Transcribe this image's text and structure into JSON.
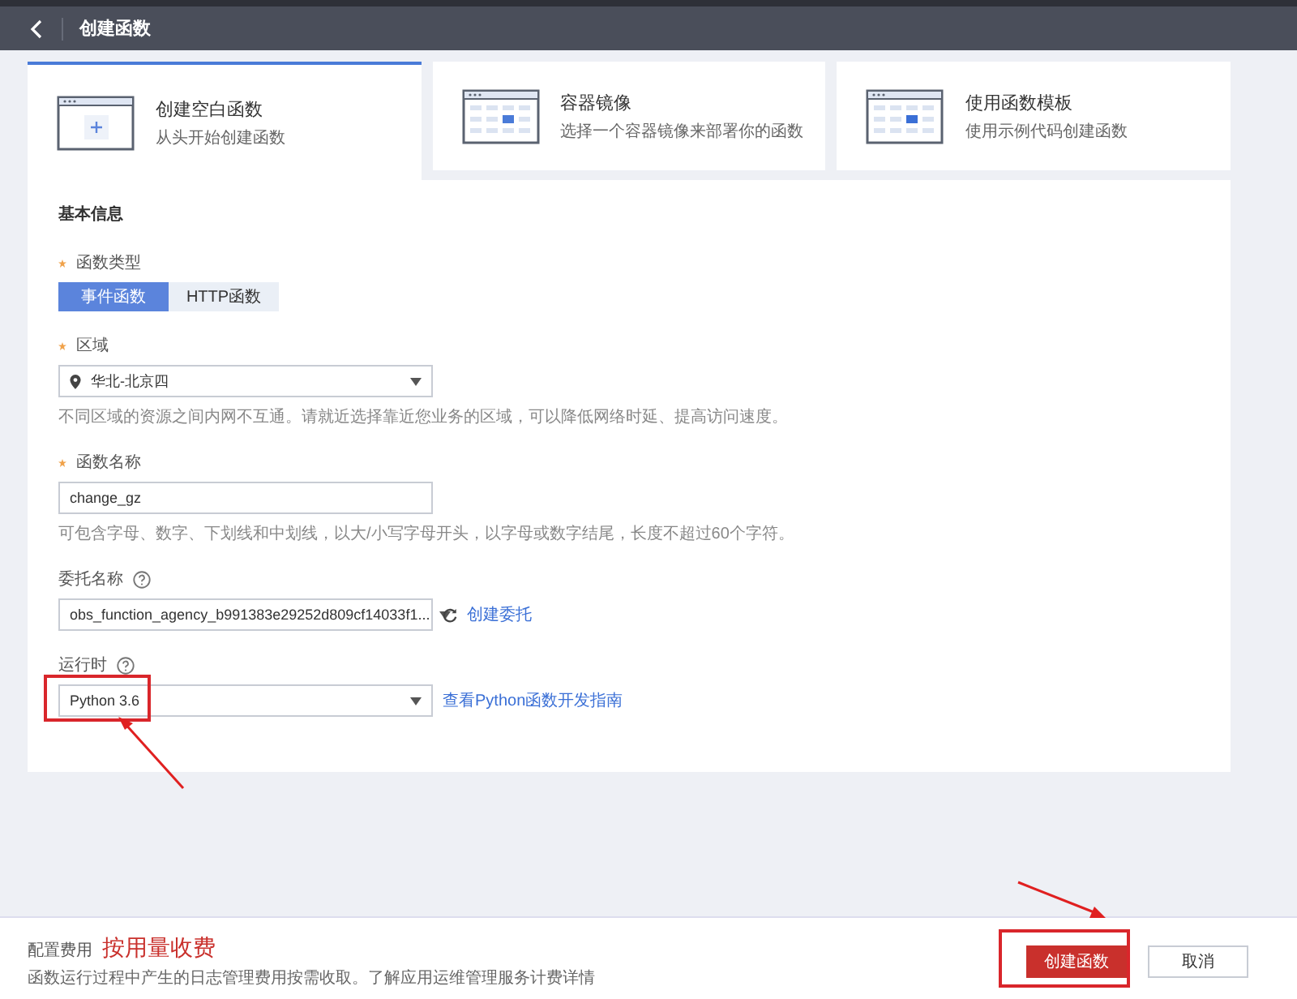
{
  "header": {
    "title": "创建函数"
  },
  "creation_modes": [
    {
      "kind": "blank",
      "title": "创建空白函数",
      "subtitle": "从头开始创建函数",
      "selected": true
    },
    {
      "kind": "image",
      "title": "容器镜像",
      "subtitle": "选择一个容器镜像来部署你的函数",
      "selected": false
    },
    {
      "kind": "template",
      "title": "使用函数模板",
      "subtitle": "使用示例代码创建函数",
      "selected": false
    }
  ],
  "form": {
    "section_title": "基本信息",
    "fields": [
      {
        "kind": "segmented",
        "label": "函数类型",
        "required": true,
        "options": [
          {
            "label": "事件函数",
            "selected": true
          },
          {
            "label": "HTTP函数",
            "selected": false
          }
        ]
      },
      {
        "kind": "location-select",
        "label": "区域",
        "required": true,
        "value": "华北-北京四",
        "hint": "不同区域的资源之间内网不互通。请就近选择靠近您业务的区域，可以降低网络时延、提高访问速度。"
      },
      {
        "kind": "input",
        "label": "函数名称",
        "required": true,
        "value": "change_gz",
        "hint": "可包含字母、数字、下划线和中划线，以大/小写字母开头，以字母或数字结尾，长度不超过60个字符。"
      },
      {
        "kind": "select",
        "label": "委托名称",
        "help": true,
        "value": "obs_function_agency_b991383e29252d809cf14033f1...",
        "refresh_link": "创建委托"
      },
      {
        "kind": "select",
        "label": "运行时",
        "help": true,
        "value": "Python 3.6",
        "link": "查看Python函数开发指南",
        "highlighted": true
      }
    ]
  },
  "footer": {
    "fee_label": "配置费用",
    "fee_value": "按用量收费",
    "note": "函数运行过程中产生的日志管理费用按需收取。了解应用运维管理服务计费详情",
    "buttons": [
      {
        "kind": "primary",
        "label": "创建函数",
        "highlighted": true
      },
      {
        "kind": "default",
        "label": "取消"
      }
    ]
  }
}
